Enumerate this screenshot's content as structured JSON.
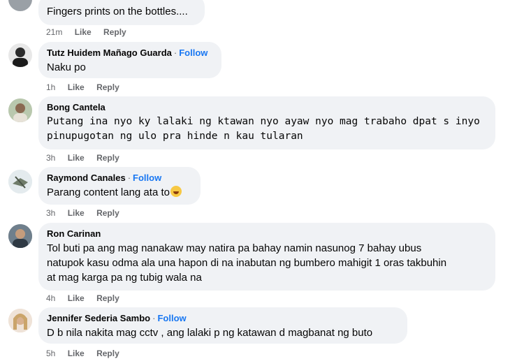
{
  "comments": [
    {
      "author": "",
      "follow": "",
      "text": "Fingers prints on the bottles....",
      "time": "21m",
      "like": "Like",
      "reply": "Reply"
    },
    {
      "author": "Tutz Huidem Mañago Guarda",
      "follow": "Follow",
      "text": "Naku po",
      "time": "1h",
      "like": "Like",
      "reply": "Reply"
    },
    {
      "author": "Bong Cantela",
      "follow": "",
      "text_lines": [
        "Putang ina nyo ky lalaki ng ktawan nyo ayaw nyo mag trabaho dpat s inyo",
        "pinupugotan ng ulo pra hinde n kau tularan"
      ],
      "time": "3h",
      "like": "Like",
      "reply": "Reply"
    },
    {
      "author": "Raymond Canales",
      "follow": "Follow",
      "text": "Parang content lang ata to",
      "emoji": "rolling-on-floor-laughing-emoji",
      "time": "3h",
      "like": "Like",
      "reply": "Reply"
    },
    {
      "author": "Ron Carinan",
      "follow": "",
      "text_lines": [
        "Tol buti pa ang mag nanakaw may natira pa bahay namin nasunog 7 bahay ubus",
        "natupok kasu odma ala una hapon di na inabutan ng bumbero mahigit 1 oras takbuhin",
        "at mag karga pa ng tubig wala na"
      ],
      "time": "4h",
      "like": "Like",
      "reply": "Reply"
    },
    {
      "author": "Jennifer Sederia Sambo",
      "follow": "Follow",
      "text": "D b nila nakita mag cctv , ang lalaki p ng katawan d magbanat ng buto",
      "time": "5h",
      "like": "Like",
      "reply": "Reply"
    }
  ],
  "colors": {
    "bubble": "#f0f2f5",
    "follow": "#1877f2",
    "meta": "#65676b",
    "text": "#050505"
  }
}
